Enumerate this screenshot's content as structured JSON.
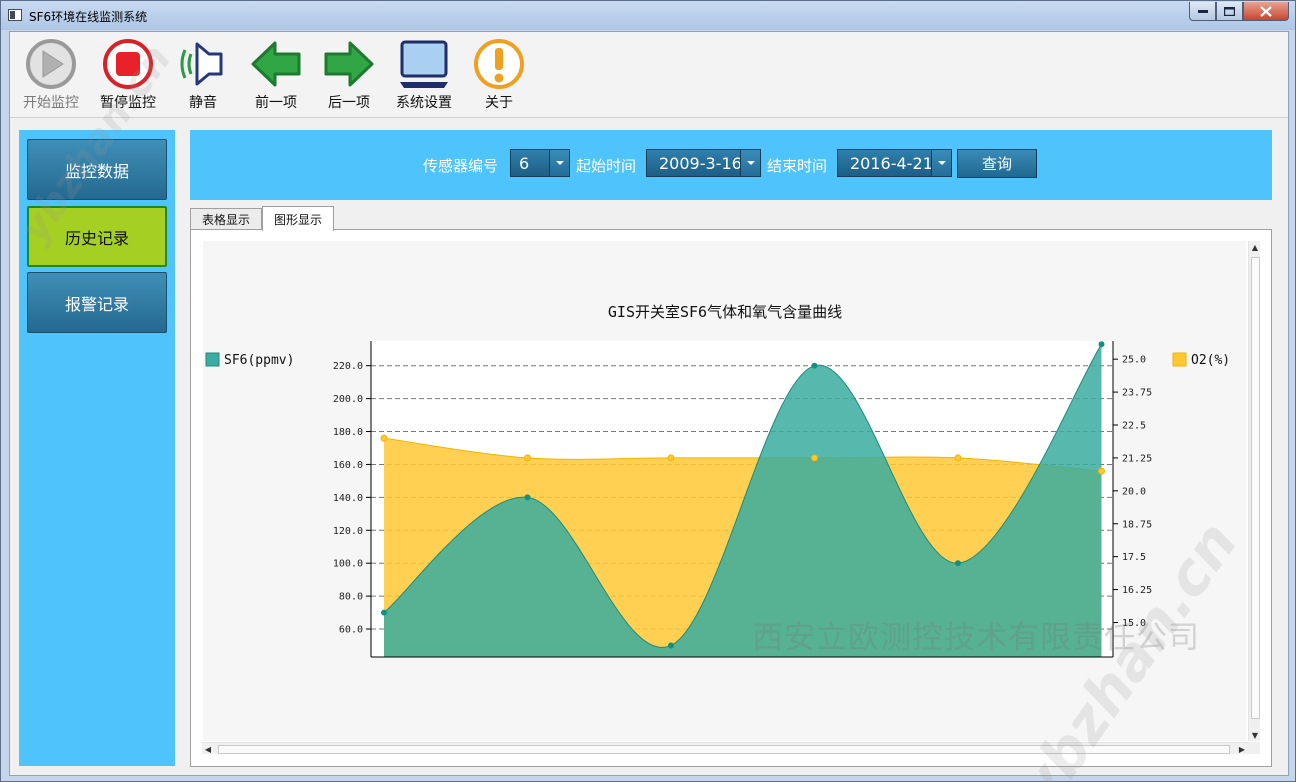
{
  "window": {
    "title": "SF6环境在线监测系统"
  },
  "toolbar": {
    "items": [
      {
        "label": "开始监控",
        "icon": "play-icon"
      },
      {
        "label": "暂停监控",
        "icon": "stop-icon"
      },
      {
        "label": "静音",
        "icon": "speaker-icon"
      },
      {
        "label": "前一项",
        "icon": "arrow-left-icon"
      },
      {
        "label": "后一项",
        "icon": "arrow-right-icon"
      },
      {
        "label": "系统设置",
        "icon": "monitor-icon"
      },
      {
        "label": "关于",
        "icon": "info-icon"
      }
    ]
  },
  "nav": {
    "items": [
      {
        "label": "监控数据"
      },
      {
        "label": "历史记录"
      },
      {
        "label": "报警记录"
      }
    ],
    "active_color": "#a5cf22"
  },
  "query": {
    "sensor_label": "传感器编号",
    "sensor_value": "6",
    "start_label": "起始时间",
    "start_value": "2009-3-16",
    "end_label": "结束时间",
    "end_value": "2016-4-21",
    "query_button": "查询"
  },
  "tabs": [
    {
      "label": "表格显示"
    },
    {
      "label": "图形显示"
    }
  ],
  "watermark": {
    "company": "西安立欧测控技术有限责任公司",
    "site": "ybzhan.cn"
  },
  "colors": {
    "sf6": "#3aada0",
    "o2": "#ffc832",
    "panel": "#4fc4fc"
  },
  "chart_data": {
    "type": "area",
    "title": "GIS开关室SF6气体和氧气含量曲线",
    "series": [
      {
        "name": "SF6(ppmv)",
        "axis": "left",
        "color": "#3aada0",
        "values": [
          70,
          140,
          50,
          220,
          100,
          233
        ]
      },
      {
        "name": "O2(%)",
        "axis": "right",
        "color": "#ffc832",
        "values": [
          22.0,
          21.25,
          21.25,
          21.25,
          21.25,
          20.75
        ]
      }
    ],
    "y_left": {
      "ticks": [
        "60.0",
        "80.0",
        "100.0",
        "120.0",
        "140.0",
        "160.0",
        "180.0",
        "200.0",
        "220.0"
      ],
      "range": [
        43,
        235
      ]
    },
    "y_right": {
      "ticks": [
        "15.0",
        "16.25",
        "17.5",
        "18.75",
        "20.0",
        "21.25",
        "22.5",
        "23.75",
        "25.0"
      ],
      "range": [
        13.69,
        25.69
      ]
    },
    "grid": true,
    "legend": [
      "left",
      "right"
    ]
  }
}
